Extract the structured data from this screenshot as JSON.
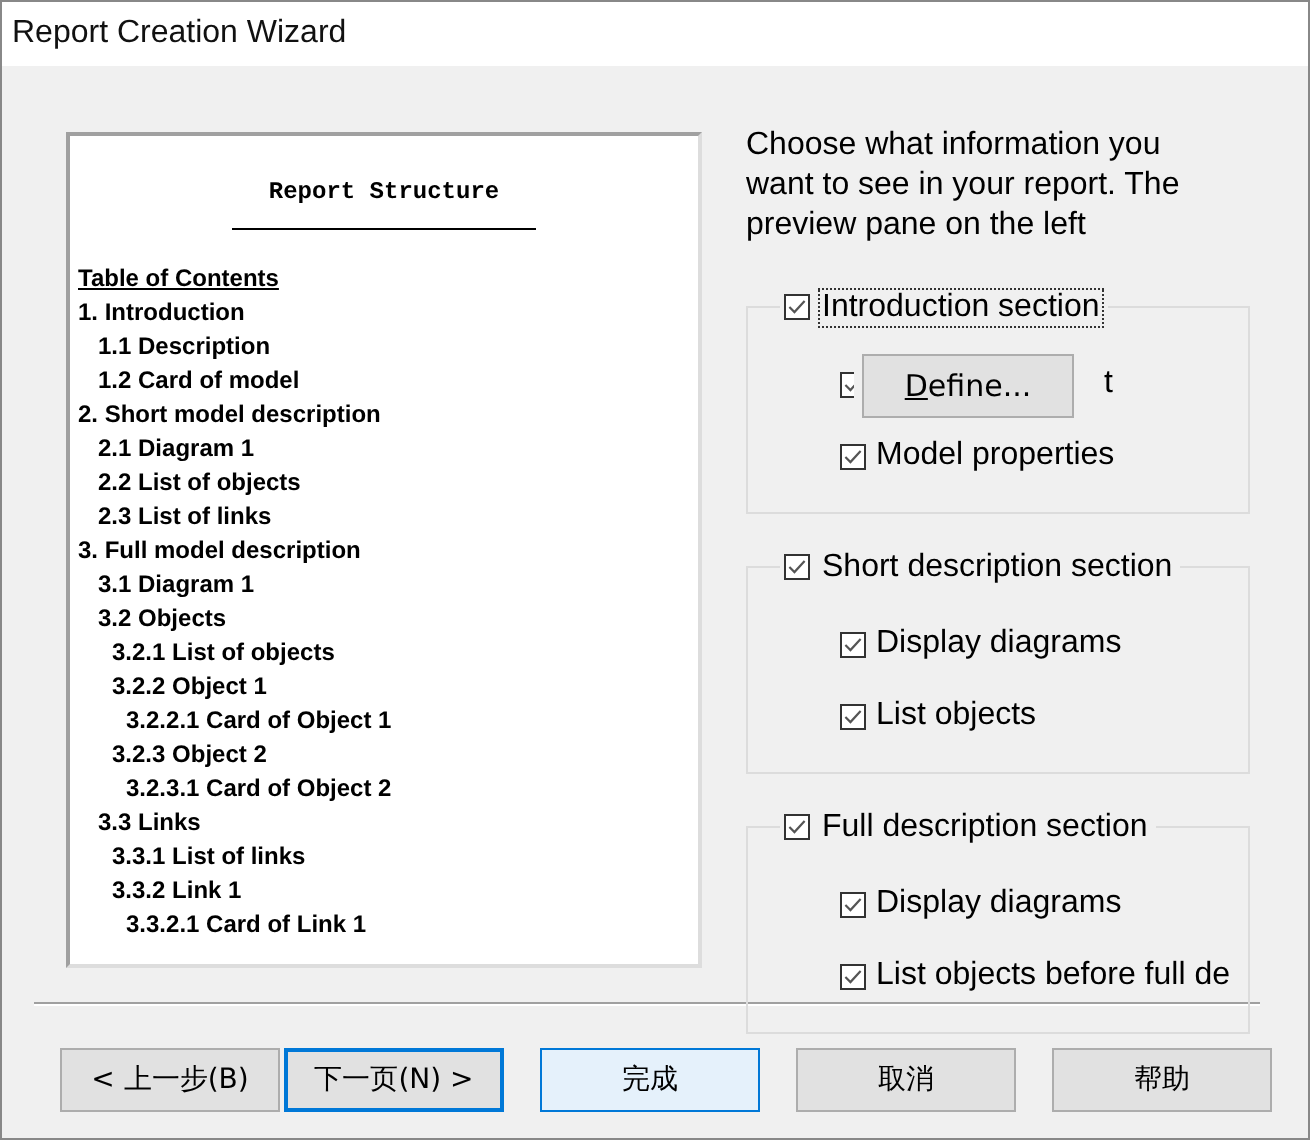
{
  "window": {
    "title": "Report Creation Wizard"
  },
  "preview": {
    "heading": "Report Structure",
    "toc_title": "Table of Contents",
    "tree": [
      {
        "label": "1. Introduction",
        "children": [
          {
            "label": "1.1 Description"
          },
          {
            "label": "1.2 Card of model"
          }
        ]
      },
      {
        "label": "2. Short model description",
        "children": [
          {
            "label": "2.1 Diagram 1"
          },
          {
            "label": "2.2 List of objects"
          },
          {
            "label": "2.3 List of links"
          }
        ]
      },
      {
        "label": "3. Full model description",
        "children": [
          {
            "label": "3.1 Diagram 1"
          },
          {
            "label": "3.2 Objects",
            "children": [
              {
                "label": "3.2.1 List of objects"
              },
              {
                "label": "3.2.2 Object 1",
                "children": [
                  {
                    "label": "3.2.2.1 Card of Object 1"
                  }
                ]
              },
              {
                "label": "3.2.3 Object 2",
                "children": [
                  {
                    "label": "3.2.3.1 Card of Object 2"
                  }
                ]
              }
            ]
          },
          {
            "label": "3.3 Links",
            "children": [
              {
                "label": "3.3.1 List of links"
              },
              {
                "label": "3.3.2 Link 1",
                "children": [
                  {
                    "label": "3.3.2.1 Card of Link 1"
                  }
                ]
              }
            ]
          }
        ]
      }
    ]
  },
  "instructions": "Choose what information you want to see in your report. The preview pane on the left",
  "groups": [
    {
      "label": "Introduction section",
      "checked": true,
      "focused": true,
      "options": [
        {
          "label": "t",
          "checked": true,
          "covered": true
        },
        {
          "label": "Model properties",
          "checked": true,
          "covered": false
        }
      ]
    },
    {
      "label": "Short description section",
      "checked": true,
      "focused": false,
      "options": [
        {
          "label": "Display diagrams",
          "checked": true,
          "covered": false
        },
        {
          "label": "List objects",
          "checked": true,
          "covered": false
        }
      ]
    },
    {
      "label": "Full description section",
      "checked": true,
      "focused": false,
      "options": [
        {
          "label": "Display diagrams",
          "checked": true,
          "covered": false
        },
        {
          "label": "List objects before full de",
          "checked": true,
          "covered": false
        }
      ]
    }
  ],
  "define_button": "Define...",
  "buttons": [
    {
      "label": "< 上一步(B)",
      "kind": "normal"
    },
    {
      "label": "下一页(N) >",
      "kind": "default"
    },
    {
      "label": "完成",
      "kind": "hover"
    },
    {
      "label": "取消",
      "kind": "normal"
    },
    {
      "label": "帮助",
      "kind": "normal"
    }
  ]
}
